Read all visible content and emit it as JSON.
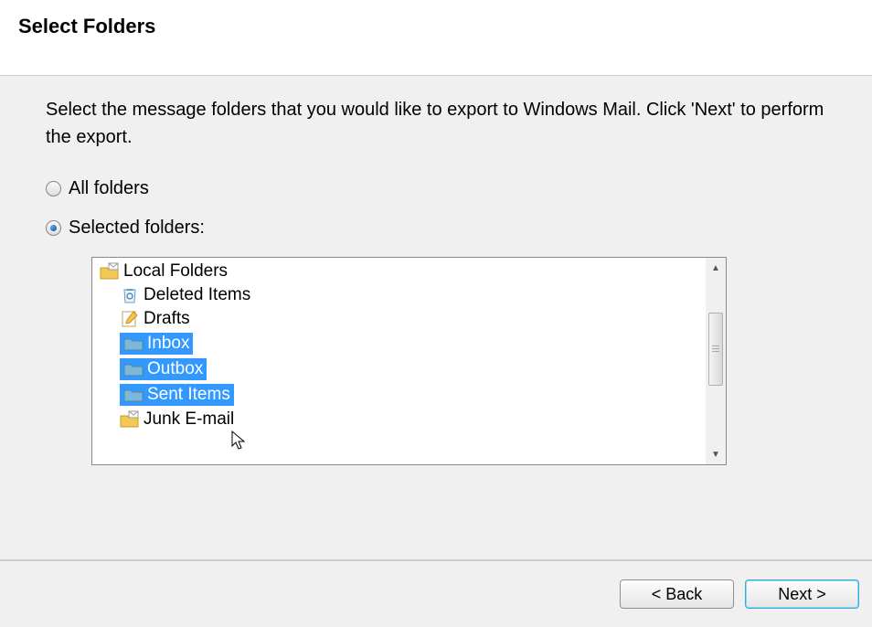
{
  "header": {
    "title": "Select Folders"
  },
  "instruction": "Select the message folders that you would like to export to Windows Mail. Click 'Next' to perform the export.",
  "radio": {
    "all_label": "All folders",
    "selected_label": "Selected folders:",
    "selected_value": "selected"
  },
  "tree": {
    "root": {
      "label": "Local Folders",
      "icon": "folder-mail"
    },
    "children": [
      {
        "label": "Deleted Items",
        "icon": "recycle-bin",
        "selected": false
      },
      {
        "label": "Drafts",
        "icon": "draft-pencil",
        "selected": false
      },
      {
        "label": "Inbox",
        "icon": "folder-blue",
        "selected": true
      },
      {
        "label": "Outbox",
        "icon": "folder-blue",
        "selected": true
      },
      {
        "label": "Sent Items",
        "icon": "folder-blue",
        "selected": true
      },
      {
        "label": "Junk E-mail",
        "icon": "folder-mail",
        "selected": false
      }
    ]
  },
  "buttons": {
    "back": "< Back",
    "next": "Next >"
  }
}
